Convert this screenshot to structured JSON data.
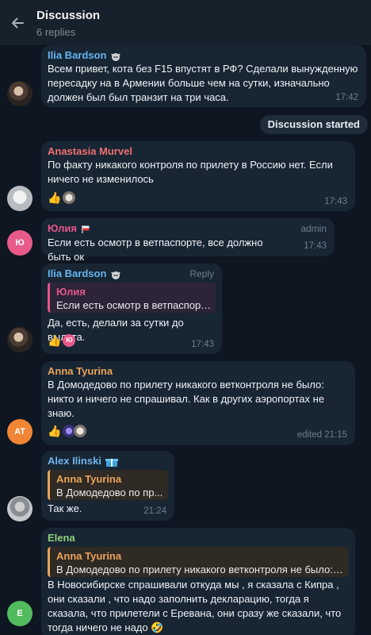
{
  "header": {
    "title": "Discussion",
    "subtitle": "6 replies"
  },
  "service_badge": "Discussion started",
  "colors": {
    "ilia": "#64b5ef",
    "anastasia": "#ee7070",
    "yulia": "#e4568b",
    "anna": "#e8a35a",
    "alex": "#6fb7ee",
    "elena": "#8fd17a"
  },
  "messages": [
    {
      "author": "Ilia Bardson",
      "text": "Всем привет, кота без F15 впустят в РФ? Сделали вынужденную пересадку на в Армении больше чем на сутки, изначально должен был был транзит на три часа.",
      "time": "17:42"
    },
    {
      "author": "Anastasia Murvel",
      "text": "По факту никакого контроля по прилету в Россию нет. Если ничего не изменилось",
      "reaction": "👍",
      "time": "17:43"
    },
    {
      "author": "Юлия",
      "avatar_initials": "Ю",
      "tag": "admin",
      "text": "Если есть осмотр в ветпаспорте, все должно быть ок",
      "time": "17:43"
    },
    {
      "author": "Ilia Bardson",
      "action": "Reply",
      "quote_author": "Юлия",
      "quote_text": "Если есть осмотр в ветпаспорт...",
      "text": "Да, есть, делали за сутки до вылета.",
      "reaction": "👍",
      "reaction_avatar": "Ю",
      "time": "17:43"
    },
    {
      "author": "Anna Tyurina",
      "avatar_initials": "AT",
      "text": "В Домодедово по прилету никакого ветконтроля не было: никто  и ничего не спрашивал. Как в других аэропортах не знаю.",
      "reaction": "👍",
      "time": "edited 21:15"
    },
    {
      "author": "Alex Ilinski",
      "quote_author": "Anna Tyurina",
      "quote_text": "В Домодедово по пр...",
      "text": "Так же.",
      "time": "21:24"
    },
    {
      "author": "Elena",
      "avatar_initials": "E",
      "quote_author": "Anna Tyurina",
      "quote_text": "В Домодедово по прилету никакого ветконтроля не было: ...",
      "text": "В Новосибирске спрашивали откуда мы , я сказала с Кипра , они сказали , что надо заполнить декларацию, тогда я сказала, что прилетели с Еревана, они сразу же сказали, что тогда ничего не надо 🤣"
    }
  ]
}
